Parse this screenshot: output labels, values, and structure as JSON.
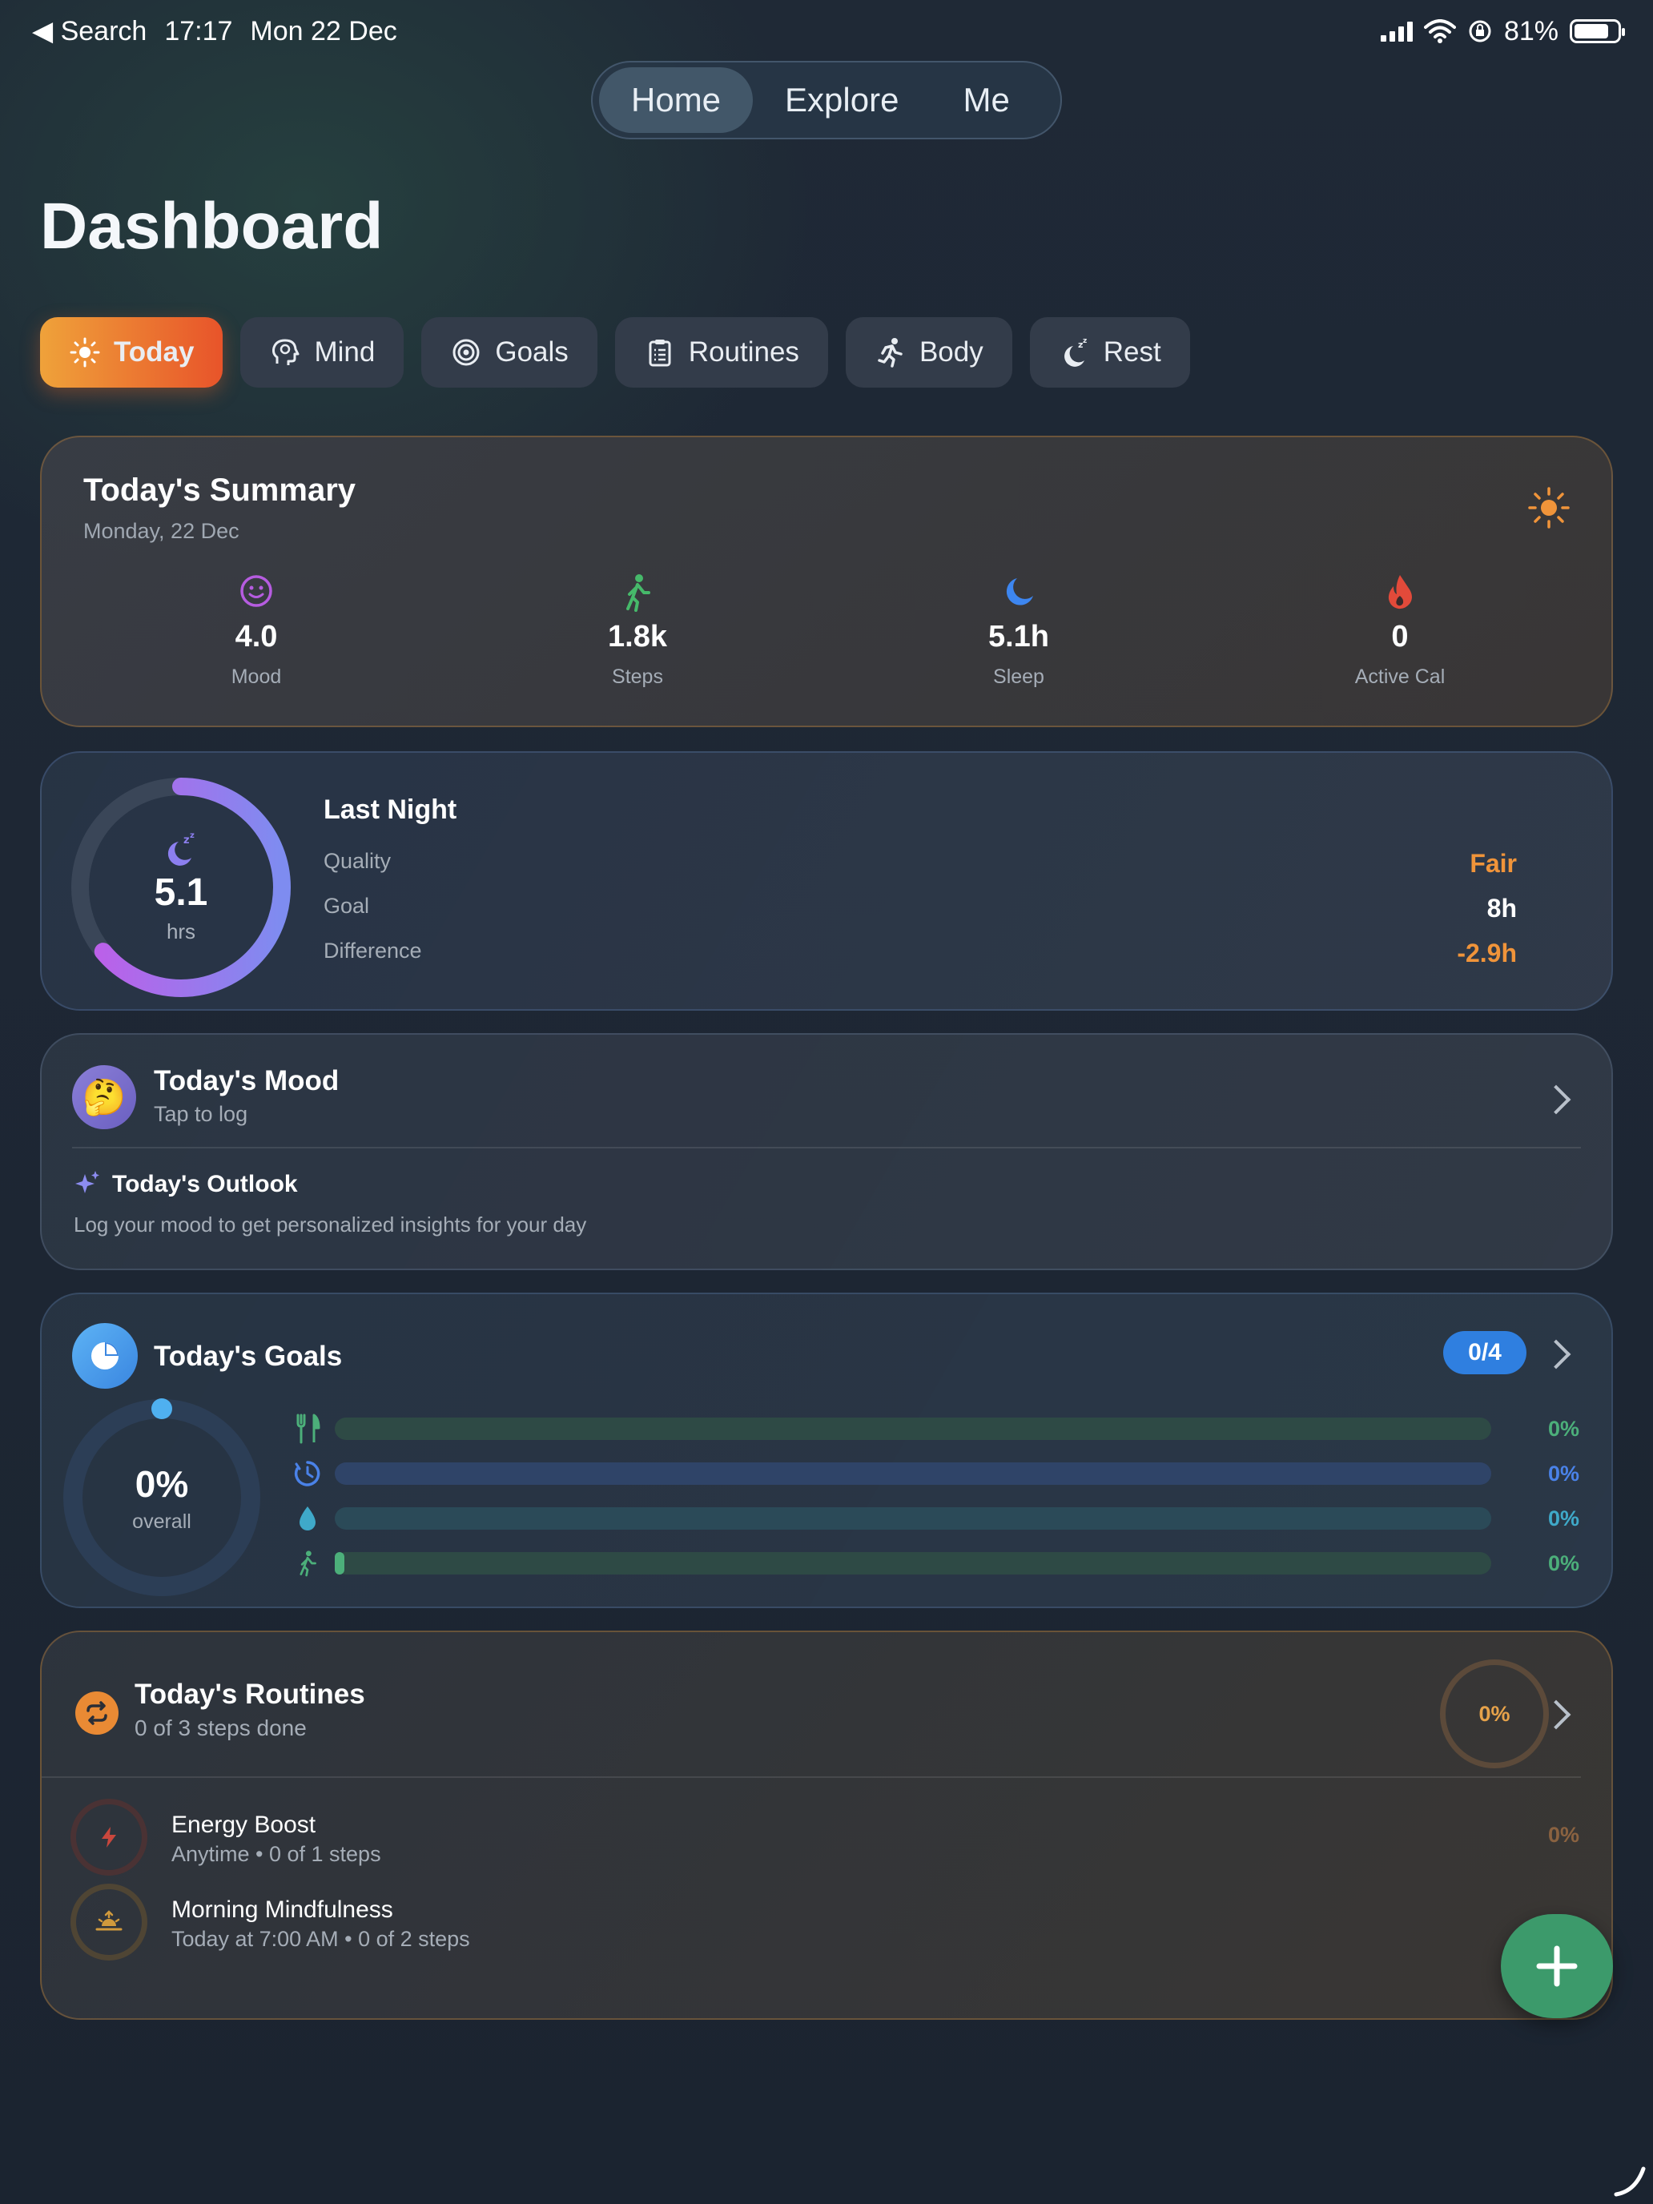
{
  "status": {
    "back_label": "◀ Search",
    "time": "17:17",
    "date": "Mon 22 Dec",
    "battery": "81%"
  },
  "topnav": {
    "tabs": [
      "Home",
      "Explore",
      "Me"
    ],
    "active": "Home"
  },
  "page_title": "Dashboard",
  "chips": [
    {
      "label": "Today",
      "icon": "sun-icon"
    },
    {
      "label": "Mind",
      "icon": "brain-icon"
    },
    {
      "label": "Goals",
      "icon": "target-icon"
    },
    {
      "label": "Routines",
      "icon": "clipboard-icon"
    },
    {
      "label": "Body",
      "icon": "running-icon"
    },
    {
      "label": "Rest",
      "icon": "moon-zzz-icon"
    }
  ],
  "summary": {
    "title": "Today's Summary",
    "subtitle": "Monday, 22 Dec",
    "stats": [
      {
        "value": "4.0",
        "label": "Mood",
        "icon": "smile-icon"
      },
      {
        "value": "1.8k",
        "label": "Steps",
        "icon": "walking-icon"
      },
      {
        "value": "5.1h",
        "label": "Sleep",
        "icon": "moon-icon"
      },
      {
        "value": "0",
        "label": "Active Cal",
        "icon": "flame-icon"
      }
    ]
  },
  "sleep": {
    "value": "5.1",
    "unit": "hrs",
    "progress": 0.64,
    "title": "Last Night",
    "rows": [
      {
        "label": "Quality",
        "value": "Fair",
        "color": "#f0943a"
      },
      {
        "label": "Goal",
        "value": "8h",
        "color": "#ffffff"
      },
      {
        "label": "Difference",
        "value": "-2.9h",
        "color": "#f0943a"
      }
    ]
  },
  "mood": {
    "emoji": "🤔",
    "title": "Today's Mood",
    "subtitle": "Tap to log",
    "outlook_title": "Today's Outlook",
    "outlook_text": "Log your mood to get personalized insights for your day"
  },
  "goals": {
    "title": "Today's Goals",
    "badge": "0/4",
    "overall_value": "0%",
    "overall_label": "overall",
    "items": [
      {
        "icon": "fork-knife-icon",
        "pct": "0%",
        "fill": 0,
        "color": "#4caf7a",
        "track": "#2e4a45"
      },
      {
        "icon": "timer-icon",
        "pct": "0%",
        "fill": 0,
        "color": "#4a82e8",
        "track": "#2f4468"
      },
      {
        "icon": "water-drop-icon",
        "pct": "0%",
        "fill": 0,
        "color": "#3fa9c9",
        "track": "#2b4a58"
      },
      {
        "icon": "walking-icon",
        "pct": "0%",
        "fill": 0.008,
        "color": "#4caf7a",
        "track": "#2e4a45"
      }
    ]
  },
  "routines": {
    "title": "Today's Routines",
    "subtitle": "0 of 3 steps done",
    "pct": "0%",
    "items": [
      {
        "name": "Energy Boost",
        "detail": "Anytime  •  0 of 1 steps",
        "pct": "0%",
        "icon": "bolt-icon"
      },
      {
        "name": "Morning Mindfulness",
        "detail": "Today at 7:00 AM  •  0 of 2 steps",
        "pct": "",
        "icon": "sunrise-icon"
      }
    ]
  }
}
